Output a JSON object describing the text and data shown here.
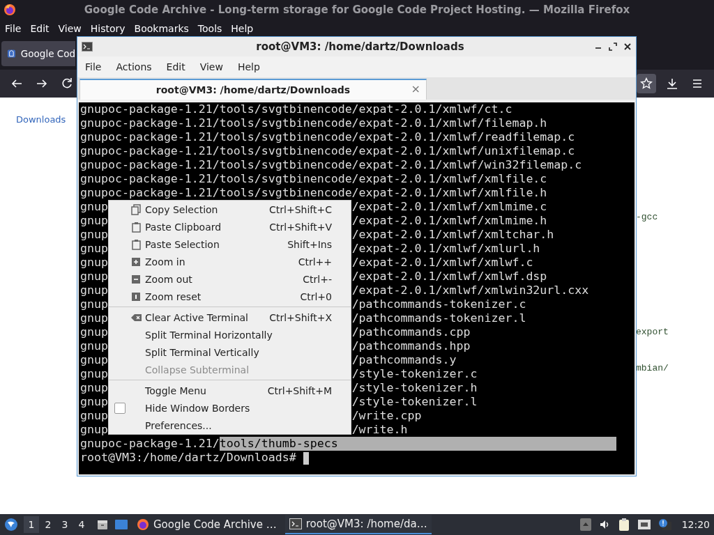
{
  "browser": {
    "title": "Google Code Archive - Long-term storage for Google Code Project Hosting. — Mozilla Firefox",
    "menu": [
      {
        "label": "File"
      },
      {
        "label": "Edit"
      },
      {
        "label": "View"
      },
      {
        "label": "History"
      },
      {
        "label": "Bookmarks"
      },
      {
        "label": "Tools"
      },
      {
        "label": "Help"
      }
    ],
    "tab": {
      "title": "Google Cod"
    },
    "page": {
      "link": "Downloads",
      "fragments": [
        "-gcc",
        "export",
        "mbian/"
      ]
    }
  },
  "terminal": {
    "title": "root@VM3: /home/dartz/Downloads",
    "menu": [
      {
        "label": "File"
      },
      {
        "label": "Actions"
      },
      {
        "label": "Edit"
      },
      {
        "label": "View"
      },
      {
        "label": "Help"
      }
    ],
    "tab": {
      "title": "root@VM3: /home/dartz/Downloads",
      "close": "×"
    },
    "lines": [
      {
        "text": "gnupoc-package-1.21/tools/svgtbinencode/expat-2.0.1/xmlwf/ct.c"
      },
      {
        "text": "gnupoc-package-1.21/tools/svgtbinencode/expat-2.0.1/xmlwf/filemap.h"
      },
      {
        "text": "gnupoc-package-1.21/tools/svgtbinencode/expat-2.0.1/xmlwf/readfilemap.c"
      },
      {
        "text": "gnupoc-package-1.21/tools/svgtbinencode/expat-2.0.1/xmlwf/unixfilemap.c"
      },
      {
        "text": "gnupoc-package-1.21/tools/svgtbinencode/expat-2.0.1/xmlwf/win32filemap.c"
      },
      {
        "text": "gnupoc-package-1.21/tools/svgtbinencode/expat-2.0.1/xmlwf/xmlfile.c"
      },
      {
        "text": "gnupoc-package-1.21/tools/svgtbinencode/expat-2.0.1/xmlwf/xmlfile.h"
      },
      {
        "left": "gnup",
        "right": "/expat-2.0.1/xmlwf/xmlmime.c"
      },
      {
        "left": "gnup",
        "right": "/expat-2.0.1/xmlwf/xmlmime.h"
      },
      {
        "left": "gnup",
        "right": "/expat-2.0.1/xmlwf/xmltchar.h"
      },
      {
        "left": "gnup",
        "right": "/expat-2.0.1/xmlwf/xmlurl.h"
      },
      {
        "left": "gnup",
        "right": "/expat-2.0.1/xmlwf/xmlwf.c"
      },
      {
        "left": "gnup",
        "right": "/expat-2.0.1/xmlwf/xmlwf.dsp"
      },
      {
        "left": "gnup",
        "right": "/expat-2.0.1/xmlwf/xmlwin32url.cxx"
      },
      {
        "left": "gnup",
        "right": "/pathcommands-tokenizer.c"
      },
      {
        "left": "gnup",
        "right": "/pathcommands-tokenizer.l"
      },
      {
        "left": "gnup",
        "right": "/pathcommands.cpp"
      },
      {
        "left": "gnup",
        "right": "/pathcommands.hpp"
      },
      {
        "left": "gnup",
        "right": "/pathcommands.y"
      },
      {
        "left": "gnup",
        "right": "/style-tokenizer.c"
      },
      {
        "left": "gnup",
        "right": "/style-tokenizer.h"
      },
      {
        "left": "gnup",
        "right": "/style-tokenizer.l"
      },
      {
        "left": "gnup",
        "right": "/write.cpp"
      },
      {
        "left": "gnup",
        "right": "/write.h"
      },
      {
        "text": "gnupoc-package-1.21/",
        "selection": "tools/thumb-specs"
      },
      {
        "text": "root@VM3:/home/dartz/Downloads#",
        "cursor": true
      }
    ]
  },
  "context_menu": {
    "items": [
      {
        "kind": "command",
        "label": "Copy Selection",
        "shortcut": "Ctrl+Shift+C",
        "disabled": false
      },
      {
        "kind": "command",
        "label": "Paste Clipboard",
        "shortcut": "Ctrl+Shift+V",
        "disabled": false
      },
      {
        "kind": "command",
        "label": "Paste Selection",
        "shortcut": "Shift+Ins",
        "disabled": false
      },
      {
        "kind": "command",
        "label": "Zoom in",
        "shortcut": "Ctrl++",
        "disabled": false
      },
      {
        "kind": "command",
        "label": "Zoom out",
        "shortcut": "Ctrl+-",
        "disabled": false
      },
      {
        "kind": "command",
        "label": "Zoom reset",
        "shortcut": "Ctrl+0",
        "disabled": false
      },
      {
        "kind": "separator"
      },
      {
        "kind": "command",
        "label": "Clear Active Terminal",
        "shortcut": "Ctrl+Shift+X",
        "disabled": false
      },
      {
        "kind": "command",
        "label": "Split Terminal Horizontally",
        "disabled": false
      },
      {
        "kind": "command",
        "label": "Split Terminal Vertically",
        "disabled": false
      },
      {
        "kind": "command",
        "label": "Collapse Subterminal",
        "disabled": true
      },
      {
        "kind": "separator"
      },
      {
        "kind": "command",
        "label": "Toggle Menu",
        "shortcut": "Ctrl+Shift+M",
        "disabled": false
      },
      {
        "kind": "check",
        "label": "Hide Window Borders",
        "checked": false,
        "disabled": false
      },
      {
        "kind": "command",
        "label": "Preferences...",
        "disabled": false
      }
    ]
  },
  "taskbar": {
    "workspaces": [
      {
        "label": "1",
        "selected": true
      },
      {
        "label": "2",
        "selected": false
      },
      {
        "label": "3",
        "selected": false
      },
      {
        "label": "4",
        "selected": false
      }
    ],
    "tasks": [
      {
        "title": "Google Code Archive …",
        "selected": false
      },
      {
        "title": "root@VM3: /home/da…",
        "selected": true
      }
    ],
    "clock": "12:20"
  }
}
